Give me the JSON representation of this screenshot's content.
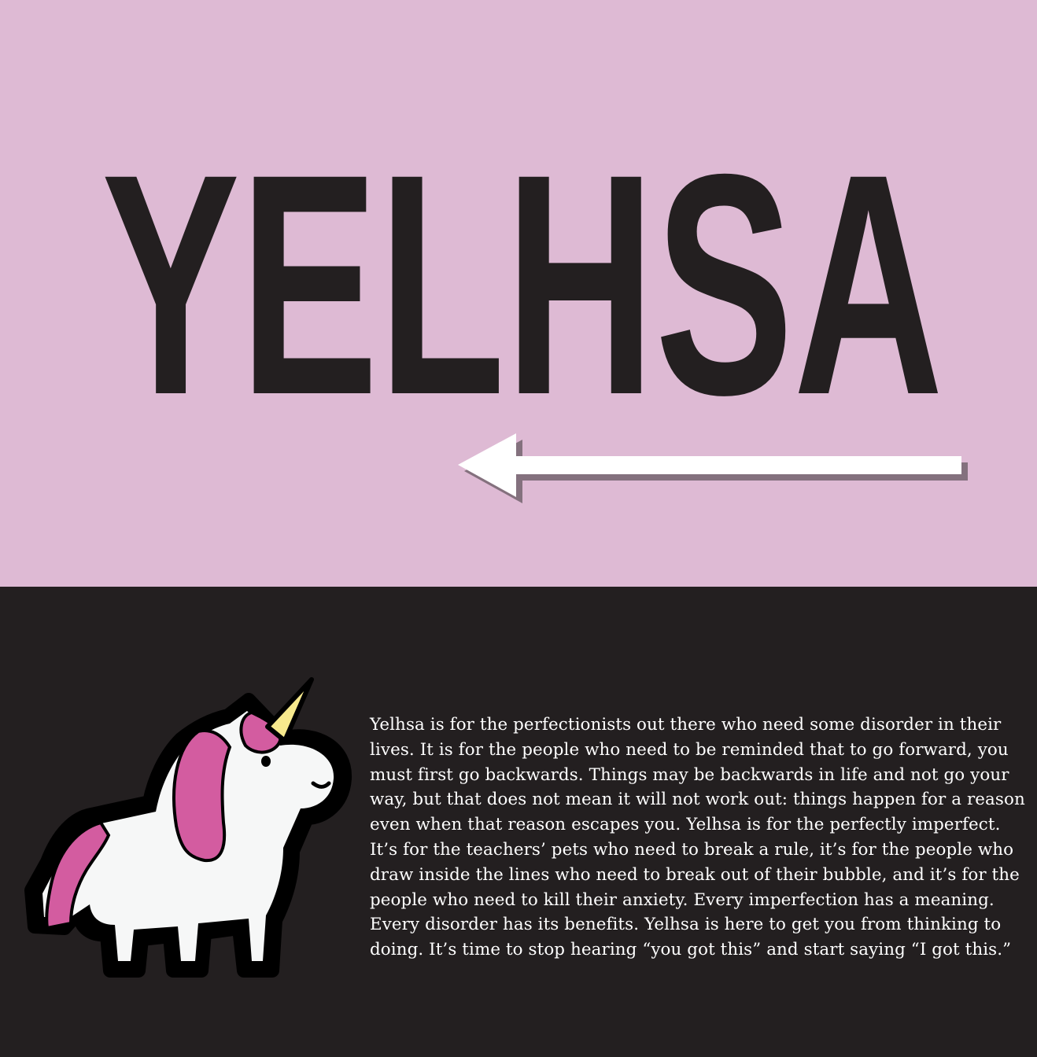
{
  "title": "YELHSA",
  "arrow_icon": "left-arrow-icon",
  "unicorn_icon": "unicorn-icon",
  "colors": {
    "top_background": "#debad4",
    "bottom_background": "#231f20",
    "title": "#231f20",
    "arrow": "#ffffff",
    "text": "#ffffff",
    "unicorn_mane": "#d35ca0",
    "unicorn_horn": "#f7e98d",
    "unicorn_body": "#f6f7f7"
  },
  "blurb": "Yelhsa is for the perfectionists out there who need some disorder in their lives. It is for the people who need to be reminded that to go forward, you must first go backwards. Things may be backwards in life and not go your way, but that does not mean it will not work out: things happen for a reason even when that reason escapes you. Yelhsa is for the perfectly imperfect. It’s for the teachers’ pets who need to break a rule, it’s for the people who draw inside the lines who need to break out of their bubble, and it’s for the people who need to kill their anxiety. Every imperfection has a meaning. Every disorder has its benefits. Yelhsa is here to get you from thinking to doing. It’s time to stop hearing “you got this” and start saying “I got this.”"
}
